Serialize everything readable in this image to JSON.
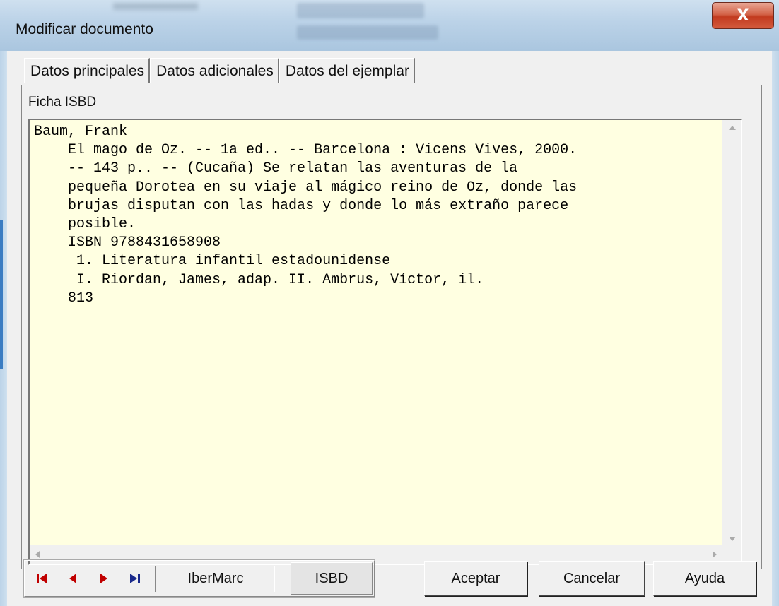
{
  "window": {
    "title": "Modificar documento",
    "close_label": "X"
  },
  "tabs": [
    {
      "label": "Datos principales"
    },
    {
      "label": "Datos adicionales"
    },
    {
      "label": "Datos del ejemplar"
    }
  ],
  "panel": {
    "label": "Ficha ISBD",
    "isbd_text": "Baum, Frank\n    El mago de Oz. -- 1a ed.. -- Barcelona : Vicens Vives, 2000.\n    -- 143 p.. -- (Cucaña) Se relatan las aventuras de la\n    pequeña Dorotea en su viaje al mágico reino de Oz, donde las\n    brujas disputan con las hadas y donde lo más extraño parece\n    posible.\n    ISBN 9788431658908\n     1. Literatura infantil estadounidense\n     I. Riordan, James, adap. II. Ambrus, Víctor, il.\n    813"
  },
  "navigation": {
    "first_icon": "first-record-icon",
    "prev_icon": "previous-record-icon",
    "next_icon": "next-record-icon",
    "last_icon": "last-record-icon",
    "ibermarc_label": "IberMarc",
    "isbd_label": "ISBD"
  },
  "buttons": {
    "accept": "Aceptar",
    "cancel": "Cancelar",
    "help": "Ayuda"
  },
  "colors": {
    "text_background": "#ffffe1",
    "nav_arrow": "#c00000",
    "close_button": "#c23a1f"
  }
}
